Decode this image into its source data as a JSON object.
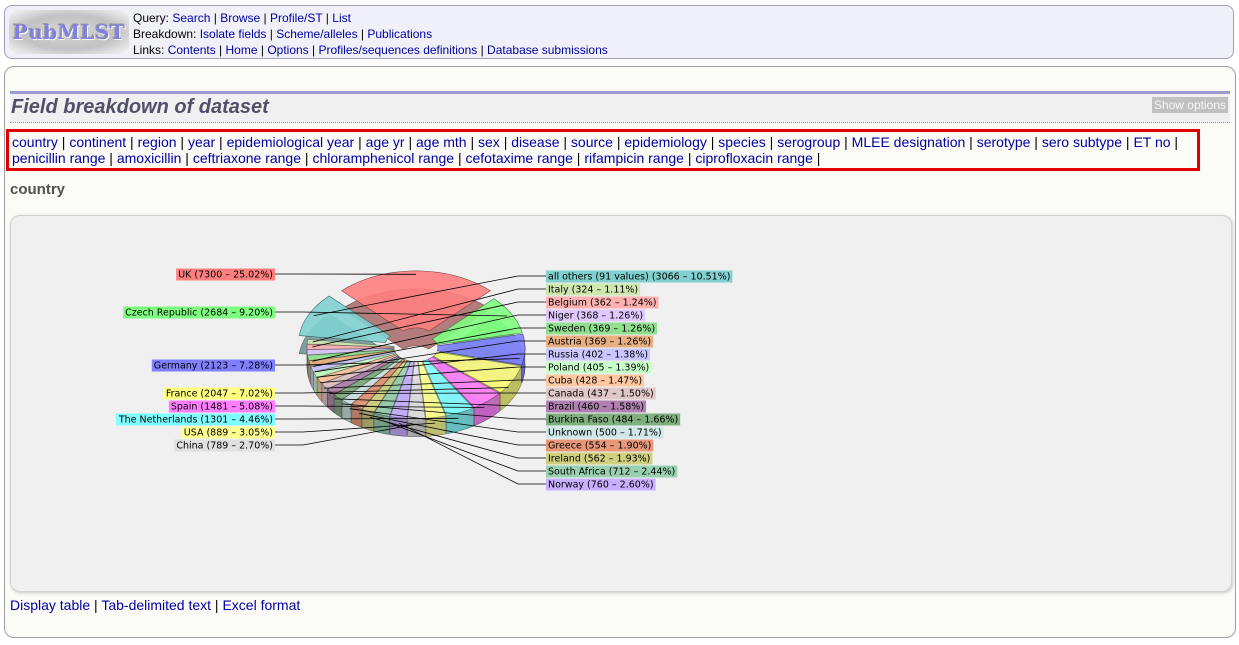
{
  "header": {
    "logo_text": "PubMLST",
    "rows": [
      {
        "label": "Query:",
        "links": [
          "Search",
          "Browse",
          "Profile/ST",
          "List"
        ]
      },
      {
        "label": "Breakdown:",
        "links": [
          "Isolate fields",
          "Scheme/alleles",
          "Publications"
        ]
      },
      {
        "label": "Links:",
        "links": [
          "Contents",
          "Home",
          "Options",
          "Profiles/sequences definitions",
          "Database submissions"
        ]
      }
    ]
  },
  "page": {
    "title": "Field breakdown of dataset",
    "show_options_label": "Show options",
    "fields": [
      "country",
      "continent",
      "region",
      "year",
      "epidemiological year",
      "age yr",
      "age mth",
      "sex",
      "disease",
      "source",
      "epidemiology",
      "species",
      "serogroup",
      "MLEE designation",
      "serotype",
      "sero subtype",
      "ET no",
      "penicillin range",
      "amoxicillin",
      "ceftriaxone range",
      "chloramphenicol range",
      "cefotaxime range",
      "rifampicin range",
      "ciprofloxacin range"
    ],
    "section_heading": "country",
    "export_links": [
      "Display table",
      "Tab-delimited text",
      "Excel format"
    ]
  },
  "chart_data": {
    "type": "pie",
    "style": "3d-exploded",
    "title": "country",
    "slices": [
      {
        "label": "UK",
        "value": 7300,
        "percent": 25.02,
        "color": "#ff7f7f",
        "side": "left"
      },
      {
        "label": "Czech Republic",
        "value": 2684,
        "percent": 9.2,
        "color": "#7fff7f",
        "side": "left"
      },
      {
        "label": "Germany",
        "value": 2123,
        "percent": 7.28,
        "color": "#7f7fff",
        "side": "left"
      },
      {
        "label": "France",
        "value": 2047,
        "percent": 7.02,
        "color": "#ffff7f",
        "side": "left"
      },
      {
        "label": "Spain",
        "value": 1481,
        "percent": 5.08,
        "color": "#ff7fff",
        "side": "left"
      },
      {
        "label": "The Netherlands",
        "value": 1301,
        "percent": 4.46,
        "color": "#7fffff",
        "side": "left"
      },
      {
        "label": "USA",
        "value": 889,
        "percent": 3.05,
        "color": "#ffff90",
        "side": "left"
      },
      {
        "label": "China",
        "value": 789,
        "percent": 2.7,
        "color": "#e0e0e0",
        "side": "left"
      },
      {
        "label": "Norway",
        "value": 760,
        "percent": 2.6,
        "color": "#c8b0ff",
        "side": "right"
      },
      {
        "label": "South Africa",
        "value": 712,
        "percent": 2.44,
        "color": "#98d0b0",
        "side": "right"
      },
      {
        "label": "Ireland",
        "value": 562,
        "percent": 1.93,
        "color": "#d0d080",
        "side": "right"
      },
      {
        "label": "Greece",
        "value": 554,
        "percent": 1.9,
        "color": "#e89878",
        "side": "right"
      },
      {
        "label": "Unknown",
        "value": 500,
        "percent": 1.71,
        "color": "#d0e8e8",
        "side": "right"
      },
      {
        "label": "Burkina Faso",
        "value": 484,
        "percent": 1.66,
        "color": "#80b080",
        "side": "right"
      },
      {
        "label": "Brazil",
        "value": 460,
        "percent": 1.58,
        "color": "#b080b0",
        "side": "right"
      },
      {
        "label": "Canada",
        "value": 437,
        "percent": 1.5,
        "color": "#e0c8c8",
        "side": "right"
      },
      {
        "label": "Cuba",
        "value": 428,
        "percent": 1.47,
        "color": "#ffc8a0",
        "side": "right"
      },
      {
        "label": "Poland",
        "value": 405,
        "percent": 1.39,
        "color": "#c8ffc8",
        "side": "right"
      },
      {
        "label": "Russia",
        "value": 402,
        "percent": 1.38,
        "color": "#c8c8ff",
        "side": "right"
      },
      {
        "label": "Austria",
        "value": 369,
        "percent": 1.26,
        "color": "#e8b080",
        "side": "right"
      },
      {
        "label": "Sweden",
        "value": 369,
        "percent": 1.26,
        "color": "#90e090",
        "side": "right"
      },
      {
        "label": "Niger",
        "value": 368,
        "percent": 1.26,
        "color": "#e0c8ff",
        "side": "right"
      },
      {
        "label": "Belgium",
        "value": 362,
        "percent": 1.24,
        "color": "#ffb0b0",
        "side": "right"
      },
      {
        "label": "Italy",
        "value": 324,
        "percent": 1.11,
        "color": "#d0e8b0",
        "side": "right"
      },
      {
        "label": "all others (91 values)",
        "value": 3066,
        "percent": 10.51,
        "color": "#80d0d0",
        "side": "right"
      }
    ]
  }
}
